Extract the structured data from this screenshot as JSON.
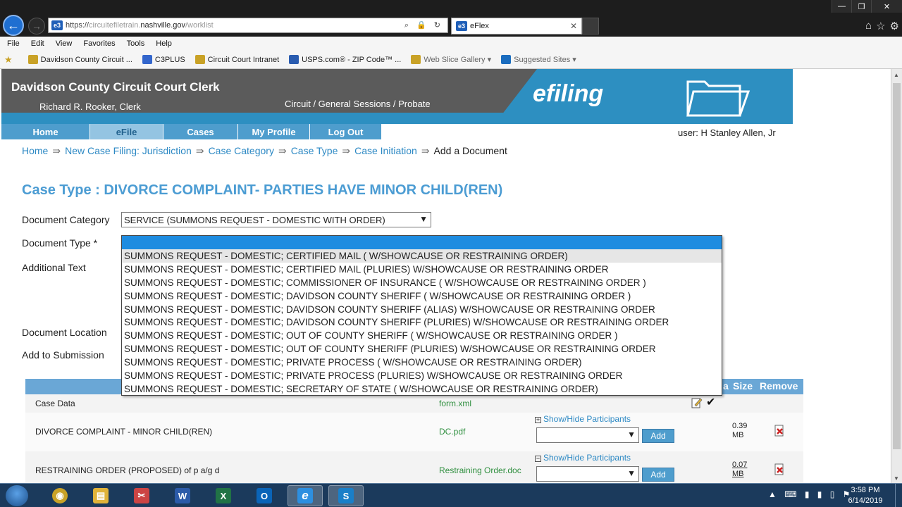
{
  "browser": {
    "url_prefix": "https://",
    "url_sub": "circuitefiletrain.",
    "url_host": "nashville.gov",
    "url_path": "/worklist",
    "addr_icons": "⌕ 🔒 ↻",
    "tab_title": "eFlex",
    "tab_close": "✕",
    "ie_badge": "e3",
    "menu": [
      "File",
      "Edit",
      "View",
      "Favorites",
      "Tools",
      "Help"
    ],
    "favorites": [
      {
        "label": "Davidson County Circuit ...",
        "color": "#c9a227"
      },
      {
        "label": "C3PLUS",
        "color": "#3366cc"
      },
      {
        "label": "Circuit Court Intranet",
        "color": "#c9a227"
      },
      {
        "label": "USPS.com® - ZIP Code™ ...",
        "color": "#2a5cb0"
      },
      {
        "label": "Web Slice Gallery ▾",
        "color": "#c9a227"
      },
      {
        "label": "Suggested Sites ▾",
        "color": "#1b6dbf"
      }
    ],
    "window_buttons": {
      "minimize": "—",
      "maximize": "❐",
      "close": "✕"
    },
    "right_icons": [
      "⌂",
      "☆",
      "⚙"
    ]
  },
  "header": {
    "title": "Davidson County Circuit Court Clerk",
    "clerk": "Richard R. Rooker, Clerk",
    "subtitle": "Circuit / General Sessions / Probate",
    "brand": "efiling"
  },
  "nav": {
    "items": [
      {
        "label": "Home",
        "width": 0
      },
      {
        "label": "eFile"
      },
      {
        "label": "Cases"
      },
      {
        "label": "My Profile"
      },
      {
        "label": "Log Out"
      }
    ],
    "user": "user: H Stanley Allen, Jr"
  },
  "breadcrumb": {
    "items": [
      "Home",
      "New Case Filing: Jurisdiction",
      "Case Category",
      "Case Type",
      "Case Initiation"
    ],
    "separator": "⇛",
    "current": "Add a Document"
  },
  "case_type": "Case Type : DIVORCE COMPLAINT- PARTIES HAVE MINOR CHILD(REN)",
  "form": {
    "document_category_label": "Document Category",
    "document_category_value": "SERVICE (SUMMONS REQUEST - DOMESTIC WITH ORDER)",
    "document_type_label": "Document Type *",
    "additional_text_label": "Additional Text",
    "document_location_label": "Document Location",
    "add_to_submission_label": "Add to Submission"
  },
  "dropdown": {
    "options": [
      "SUMMONS REQUEST - DOMESTIC; CERTIFIED MAIL ( W/SHOWCAUSE OR RESTRAINING ORDER)",
      "SUMMONS REQUEST - DOMESTIC; CERTIFIED MAIL (PLURIES) W/SHOWCAUSE OR RESTRAINING ORDER",
      "SUMMONS REQUEST - DOMESTIC; COMMISSIONER OF INSURANCE ( W/SHOWCAUSE OR RESTRAINING ORDER )",
      "SUMMONS REQUEST - DOMESTIC; DAVIDSON COUNTY SHERIFF ( W/SHOWCAUSE OR RESTRAINING ORDER )",
      "SUMMONS REQUEST - DOMESTIC; DAVIDSON COUNTY SHERIFF (ALIAS) W/SHOWCAUSE OR RESTRAINING ORDER",
      "SUMMONS REQUEST - DOMESTIC; DAVIDSON COUNTY SHERIFF (PLURIES) W/SHOWCAUSE OR RESTRAINING ORDER",
      "SUMMONS REQUEST - DOMESTIC; OUT OF COUNTY SHERIFF ( W/SHOWCAUSE OR RESTRAINING ORDER )",
      "SUMMONS REQUEST - DOMESTIC; OUT OF COUNTY SHERIFF (PLURIES) W/SHOWCAUSE OR RESTRAINING ORDER",
      "SUMMONS REQUEST - DOMESTIC; PRIVATE PROCESS ( W/SHOWCAUSE OR RESTRAINING ORDER)",
      "SUMMONS REQUEST - DOMESTIC; PRIVATE PROCESS (PLURIES) W/SHOWCAUSE OR RESTRAINING ORDER",
      "SUMMONS REQUEST - DOMESTIC; SECRETARY OF STATE ( W/SHOWCAUSE OR RESTRAINING ORDER)"
    ]
  },
  "table": {
    "headers": {
      "a": "a",
      "size": "Size",
      "remove": "Remove"
    },
    "rows": [
      {
        "name": "Case Data",
        "file": "form.xml",
        "size": ""
      },
      {
        "name": "DIVORCE COMPLAINT - MINOR CHILD(REN)",
        "file": "DC.pdf",
        "size": "0.39 MB"
      },
      {
        "name": "RESTRAINING ORDER (PROPOSED) of p a/g d",
        "file": "Restraining Order.doc",
        "size": "0.07 MB"
      }
    ],
    "show_hide_label": "Show/Hide Participants",
    "add_label": "Add"
  },
  "taskbar": {
    "time": "3:58 PM",
    "date": "6/14/2019",
    "tray": "▲ ⌨ ▮ ▮ ▯ ⚑",
    "apps": [
      {
        "name": "chrome",
        "glyph": "◉",
        "color": "#c9a227"
      },
      {
        "name": "explorer",
        "glyph": "▤",
        "color": "#e0b33a"
      },
      {
        "name": "snipping",
        "glyph": "✂",
        "color": "#cc4444"
      },
      {
        "name": "word",
        "glyph": "W",
        "color": "#2b5aa8"
      },
      {
        "name": "excel",
        "glyph": "X",
        "color": "#217346"
      },
      {
        "name": "outlook",
        "glyph": "O",
        "color": "#0a64b8"
      },
      {
        "name": "ie",
        "glyph": "e",
        "color": "#2d8fe0"
      },
      {
        "name": "skype",
        "glyph": "S",
        "color": "#1a7fc8"
      }
    ]
  },
  "colors": {
    "accent_blue": "#2d8fc1",
    "link_blue": "#2d89c4",
    "header_gray": "#5b5b5b",
    "file_green": "#2f8f3f",
    "selected_option": "#1e8ce0"
  }
}
